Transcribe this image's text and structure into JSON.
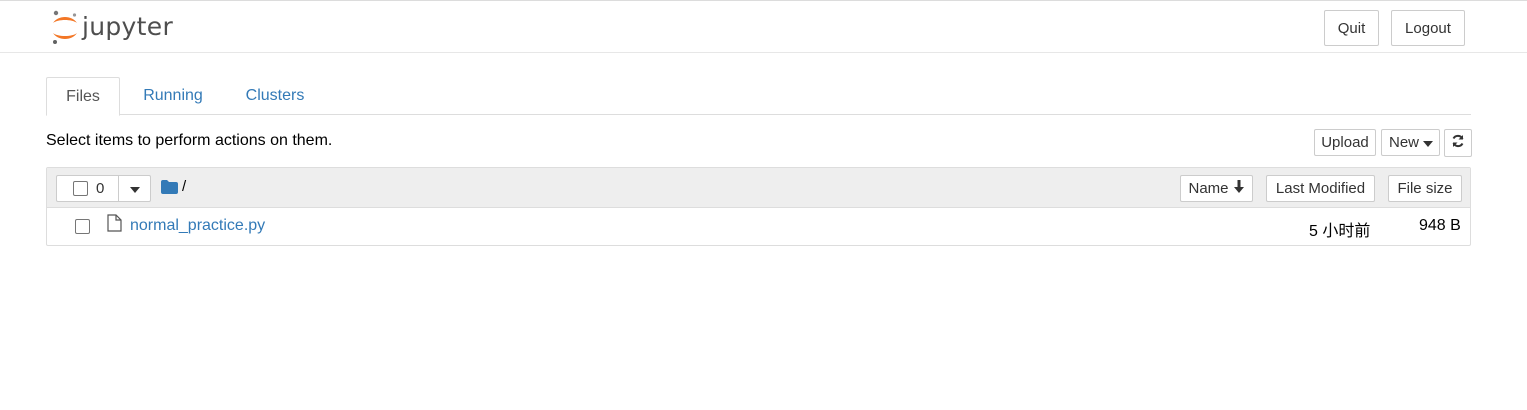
{
  "header": {
    "logo_text": "jupyter",
    "quit_label": "Quit",
    "logout_label": "Logout"
  },
  "tabs": [
    {
      "label": "Files",
      "active": true
    },
    {
      "label": "Running",
      "active": false
    },
    {
      "label": "Clusters",
      "active": false
    }
  ],
  "toolbar": {
    "hint": "Select items to perform actions on them.",
    "upload_label": "Upload",
    "new_label": "New"
  },
  "list_header": {
    "selected_count": "0",
    "path": "/",
    "sort_name_label": "Name",
    "sort_modified_label": "Last Modified",
    "sort_size_label": "File size"
  },
  "files": [
    {
      "name": "normal_practice.py",
      "modified": "5 小时前",
      "size": "948 B"
    }
  ],
  "colors": {
    "link": "#337ab7",
    "logo_orange": "#f37726",
    "logo_gray": "#4e4e4e",
    "folder": "#337ab7"
  },
  "icons": {
    "logo": "jupyter-logo-icon",
    "folder": "folder-icon",
    "file": "file-icon",
    "refresh": "refresh-icon",
    "caret": "caret-down-icon",
    "sort_arrow": "arrow-down-icon"
  }
}
